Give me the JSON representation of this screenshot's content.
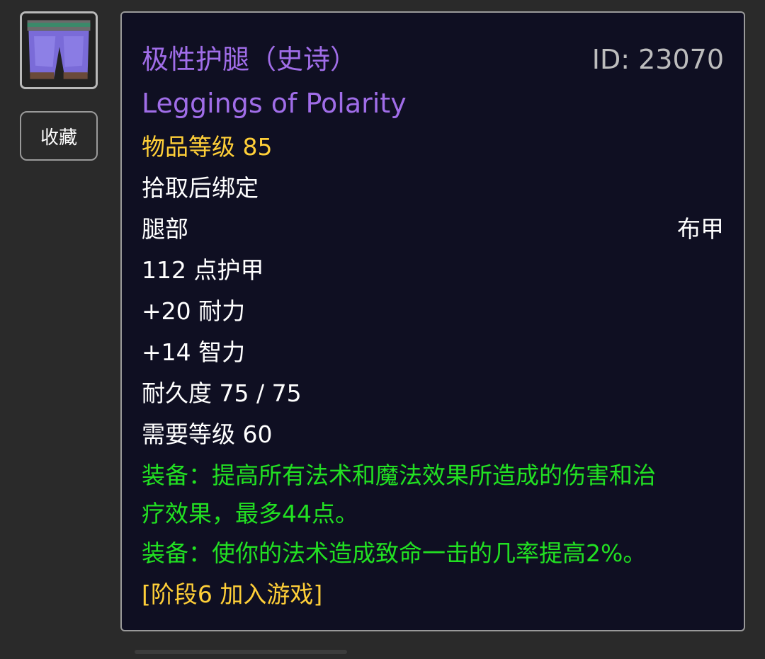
{
  "item": {
    "icon": "leggings-icon",
    "name_cn": "极性护腿（史诗）",
    "id_label": "ID: 23070",
    "name_en": "Leggings of Polarity",
    "item_level": "物品等级 85",
    "bind": "拾取后绑定",
    "slot": "腿部",
    "armor_type": "布甲",
    "armor": "112 点护甲",
    "stat_stamina": "+20 耐力",
    "stat_intellect": "+14 智力",
    "durability": "耐久度 75 / 75",
    "required_level": "需要等级 60",
    "equip1_line1": "装备：提高所有法术和魔法效果所造成的伤害和治",
    "equip1_line2": "疗效果，最多44点。",
    "equip2": "装备：使你的法术造成致命一击的几率提高2%。",
    "phase": "[阶段6 加入游戏]"
  },
  "actions": {
    "favorite_label": "收藏"
  },
  "colors": {
    "epic": "#a06de8",
    "item_level": "#ffcf38",
    "equip": "#22e022",
    "phase": "#ffcf38",
    "background": "#0f0f22"
  }
}
